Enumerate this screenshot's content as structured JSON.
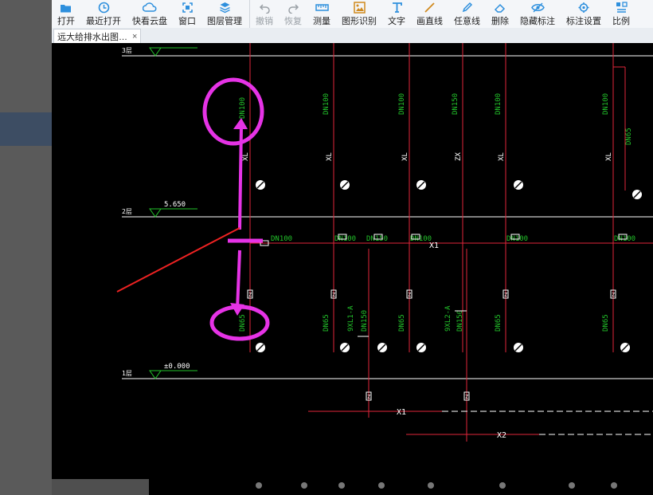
{
  "toolbar": {
    "items": [
      {
        "label": "打开",
        "icon": "folder-open-icon"
      },
      {
        "label": "最近打开",
        "icon": "clock-icon"
      },
      {
        "label": "快看云盘",
        "icon": "cloud-icon"
      },
      {
        "label": "窗口",
        "icon": "window-icon"
      },
      {
        "label": "图层管理",
        "icon": "layers-icon"
      },
      {
        "label": "撤销",
        "icon": "undo-icon",
        "disabled": true
      },
      {
        "label": "恢复",
        "icon": "redo-icon",
        "disabled": true
      },
      {
        "label": "测量",
        "icon": "ruler-icon"
      },
      {
        "label": "图形识别",
        "icon": "image-recognize-icon"
      },
      {
        "label": "文字",
        "icon": "text-icon"
      },
      {
        "label": "画直线",
        "icon": "line-icon"
      },
      {
        "label": "任意线",
        "icon": "pencil-icon"
      },
      {
        "label": "删除",
        "icon": "eraser-icon"
      },
      {
        "label": "隐藏标注",
        "icon": "eye-icon"
      },
      {
        "label": "标注设置",
        "icon": "annotation-settings-icon"
      },
      {
        "label": "比例",
        "icon": "scale-icon"
      }
    ]
  },
  "tab": {
    "title": "远大给排水出图…",
    "close": "×"
  },
  "drawing": {
    "floors": [
      {
        "mark": "3层",
        "elevation": ""
      },
      {
        "mark": "2层",
        "elevation": "5.650"
      },
      {
        "mark": "1层",
        "elevation": "±0.000"
      }
    ],
    "upper_pipe_labels": [
      "DN100",
      "DN100",
      "DN100",
      "DN150",
      "DN100",
      "DN100",
      "DN65"
    ],
    "riser_codes_upper": [
      "XL",
      "XL",
      "XL",
      "ZX",
      "XL",
      "XL"
    ],
    "header_labels": [
      "DN100",
      "DN100",
      "DN150",
      "DN100",
      "DN100",
      "DN100"
    ],
    "main_pipe": "X1",
    "lower_pipe_labels": [
      "DN65",
      "DN65",
      "DN150",
      "DN65",
      "DN150",
      "DN65",
      "DN65"
    ],
    "riser_ids": [
      "9XL1-A",
      "9XL2-A"
    ],
    "bottom_pipes": [
      "X1",
      "X2"
    ],
    "valve_mark": "Z"
  },
  "colors": {
    "pipe": "#e0263a",
    "label": "#22c22a",
    "annotation": "#e633e6",
    "arrow": "#ee2222",
    "floor": "#ffffff"
  }
}
